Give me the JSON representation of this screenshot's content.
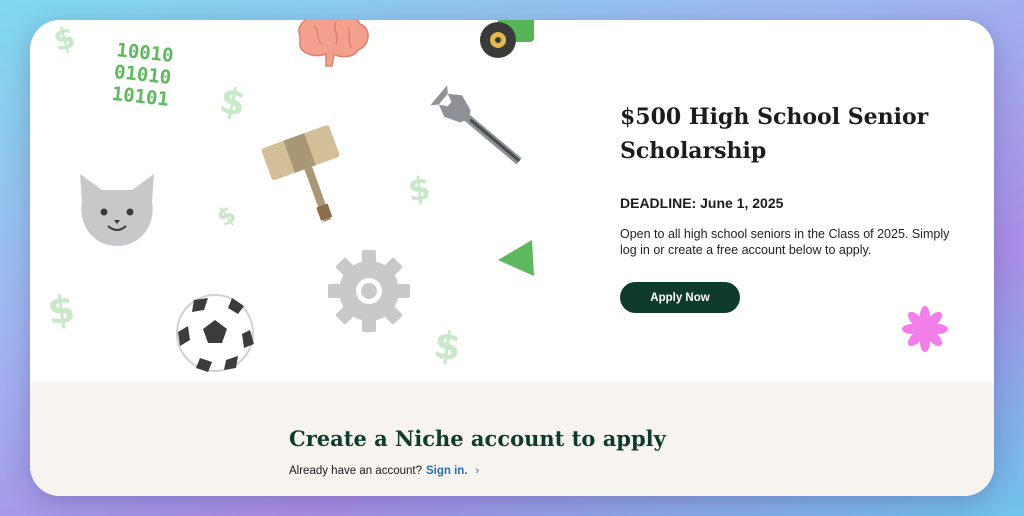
{
  "hero": {
    "binary_lines": [
      "10010",
      "01010",
      "10101"
    ],
    "dollar_sign": "$",
    "title": "$500 High School Senior Scholarship",
    "deadline": "DEADLINE: June 1, 2025",
    "description": "Open to all high school seniors in the Class of 2025. Simply log in or create a free account below to apply.",
    "apply_button": "Apply Now"
  },
  "signup": {
    "heading": "Create a Niche account to apply",
    "prompt": "Already have an account?",
    "signin_link": "Sign in.",
    "chevron": "›"
  },
  "colors": {
    "primary": "#0f3b2d",
    "link": "#2b6fb3",
    "bottom_bg": "#f7f3ef",
    "dollar": "#c9e7c9",
    "binary": "#5fb85f",
    "flower": "#f27ee9"
  },
  "icons": [
    "dollar-icon",
    "brain-icon",
    "tractor-icon",
    "wrench-icon",
    "gavel-icon",
    "cat-icon",
    "gear-icon",
    "soccer-ball-icon",
    "green-triangle-icon",
    "flower-icon"
  ]
}
